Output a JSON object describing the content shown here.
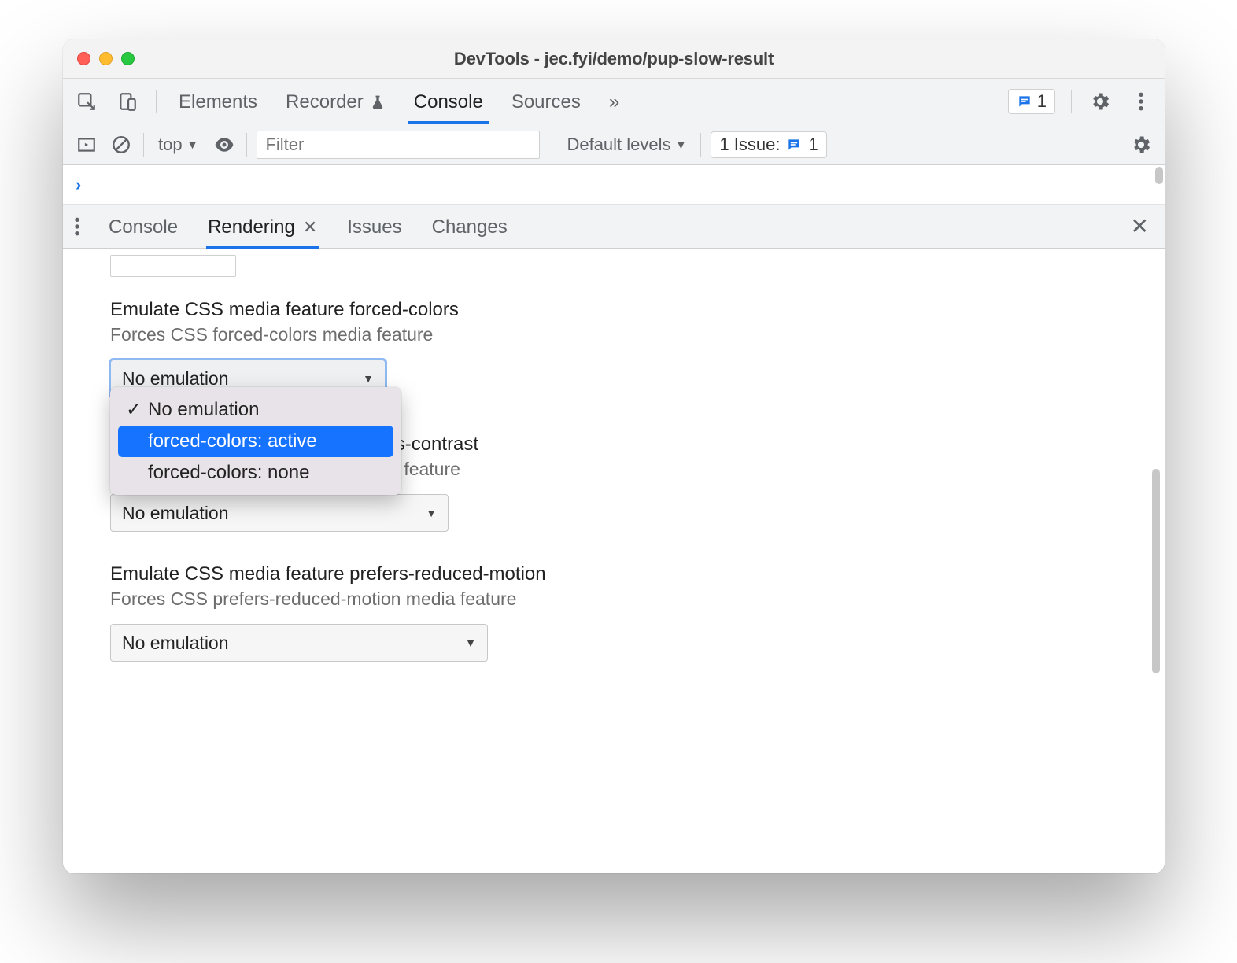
{
  "window": {
    "title": "DevTools - jec.fyi/demo/pup-slow-result"
  },
  "tabs": {
    "items": [
      "Elements",
      "Recorder",
      "Console",
      "Sources"
    ],
    "active": "Console",
    "moreGlyph": "»",
    "topIssueCount": "1"
  },
  "consoleToolbar": {
    "context": "top",
    "filterPlaceholder": "Filter",
    "levels": "Default levels",
    "issues": {
      "label": "1 Issue:",
      "count": "1"
    }
  },
  "drawer": {
    "tabs": [
      "Console",
      "Rendering",
      "Issues",
      "Changes"
    ],
    "active": "Rendering"
  },
  "sections": {
    "forcedColors": {
      "title": "Emulate CSS media feature forced-colors",
      "sub": "Forces CSS forced-colors media feature",
      "value": "No emulation",
      "options": [
        "No emulation",
        "forced-colors: active",
        "forced-colors: none"
      ],
      "highlightIndex": 1,
      "checkedIndex": 0
    },
    "prefersContrast": {
      "title": "Emulate CSS media feature prefers-contrast",
      "sub": "Forces CSS prefers-contrast media feature",
      "value": "No emulation"
    },
    "prefersReducedMotion": {
      "title": "Emulate CSS media feature prefers-reduced-motion",
      "sub": "Forces CSS prefers-reduced-motion media feature",
      "value": "No emulation"
    }
  }
}
